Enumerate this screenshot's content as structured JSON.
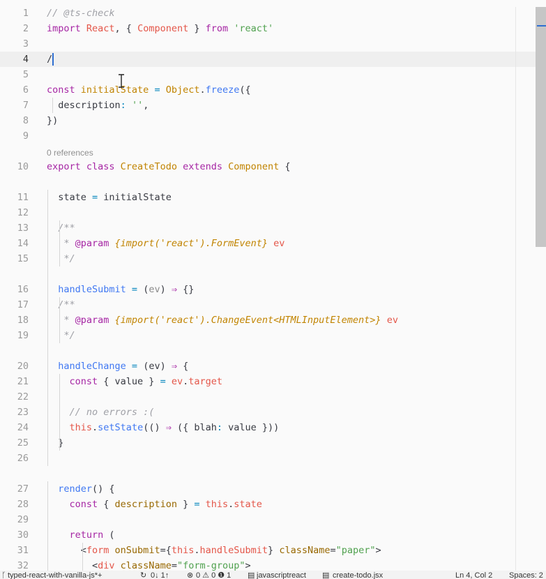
{
  "editor": {
    "codelens": "0 references",
    "lines": [
      {
        "n": "1",
        "tokens": [
          [
            "c",
            "// @ts-check"
          ]
        ]
      },
      {
        "n": "2",
        "tokens": [
          [
            "k",
            "import "
          ],
          [
            "v",
            "React"
          ],
          [
            "pl",
            ", { "
          ],
          [
            "v",
            "Component"
          ],
          [
            "pl",
            " } "
          ],
          [
            "k",
            "from "
          ],
          [
            "s",
            "'react'"
          ]
        ]
      },
      {
        "n": "3",
        "tokens": []
      },
      {
        "n": "4",
        "tokens": [
          [
            "pl",
            "/"
          ]
        ],
        "current": true
      },
      {
        "n": "5",
        "tokens": []
      },
      {
        "n": "6",
        "tokens": [
          [
            "k",
            "const "
          ],
          [
            "cls",
            "initialState"
          ],
          [
            "p",
            " = "
          ],
          [
            "cls",
            "Object"
          ],
          [
            "pl",
            "."
          ],
          [
            "fn",
            "freeze"
          ],
          [
            "pl",
            "({"
          ]
        ]
      },
      {
        "n": "7",
        "tokens": [
          [
            "pl",
            "  description"
          ],
          [
            "p",
            ": "
          ],
          [
            "s",
            "''"
          ],
          [
            "pl",
            ","
          ]
        ]
      },
      {
        "n": "8",
        "tokens": [
          [
            "pl",
            "})"
          ]
        ]
      },
      {
        "n": "9",
        "tokens": []
      },
      {
        "n": "10",
        "tokens": [
          [
            "k",
            "export class "
          ],
          [
            "cls",
            "CreateTodo "
          ],
          [
            "k",
            "extends "
          ],
          [
            "cls",
            "Component"
          ],
          [
            "pl",
            " {"
          ]
        ]
      },
      {
        "n": "11",
        "tokens": [
          [
            "pl",
            "  state "
          ],
          [
            "p",
            "= "
          ],
          [
            "pl",
            "initialState"
          ]
        ]
      },
      {
        "n": "12",
        "tokens": []
      },
      {
        "n": "13",
        "tokens": [
          [
            "c",
            "  /**"
          ]
        ]
      },
      {
        "n": "14",
        "tokens": [
          [
            "c",
            "   * "
          ],
          [
            "k",
            "@param "
          ],
          [
            "ty",
            "{import('react').FormEvent} "
          ],
          [
            "tag",
            "ev"
          ]
        ]
      },
      {
        "n": "15",
        "tokens": [
          [
            "c",
            "   */"
          ]
        ]
      },
      {
        "n": "16",
        "tokens": [
          [
            "fn",
            "  handleSubmit "
          ],
          [
            "p",
            "= "
          ],
          [
            "pl",
            "("
          ],
          [
            "pa",
            "ev"
          ],
          [
            "pl",
            ") "
          ],
          [
            "op",
            "⇒ "
          ],
          [
            "pl",
            "{}"
          ]
        ]
      },
      {
        "n": "17",
        "tokens": [
          [
            "c",
            "  /**"
          ]
        ]
      },
      {
        "n": "18",
        "tokens": [
          [
            "c",
            "   * "
          ],
          [
            "k",
            "@param "
          ],
          [
            "ty",
            "{import('react').ChangeEvent<HTMLInputElement>} "
          ],
          [
            "tag",
            "ev"
          ]
        ]
      },
      {
        "n": "19",
        "tokens": [
          [
            "c",
            "   */"
          ]
        ]
      },
      {
        "n": "20",
        "tokens": [
          [
            "fn",
            "  handleChange "
          ],
          [
            "p",
            "= "
          ],
          [
            "pl",
            "(ev) "
          ],
          [
            "op",
            "⇒ "
          ],
          [
            "pl",
            "{"
          ]
        ]
      },
      {
        "n": "21",
        "tokens": [
          [
            "k",
            "    const "
          ],
          [
            "pl",
            "{ value } "
          ],
          [
            "p",
            "= "
          ],
          [
            "v",
            "ev"
          ],
          [
            "pl",
            "."
          ],
          [
            "v",
            "target"
          ]
        ]
      },
      {
        "n": "22",
        "tokens": []
      },
      {
        "n": "23",
        "tokens": [
          [
            "c",
            "    // no errors :("
          ]
        ]
      },
      {
        "n": "24",
        "tokens": [
          [
            "v",
            "    this"
          ],
          [
            "pl",
            "."
          ],
          [
            "fn",
            "setState"
          ],
          [
            "pl",
            "(() "
          ],
          [
            "op",
            "⇒ "
          ],
          [
            "pl",
            "({ blah"
          ],
          [
            "p",
            ": "
          ],
          [
            "pl",
            "value }))"
          ]
        ]
      },
      {
        "n": "25",
        "tokens": [
          [
            "pl",
            "  }"
          ]
        ]
      },
      {
        "n": "26",
        "tokens": []
      },
      {
        "n": "27",
        "tokens": [
          [
            "fn",
            "  render"
          ],
          [
            "pl",
            "() {"
          ]
        ]
      },
      {
        "n": "28",
        "tokens": [
          [
            "k",
            "    const "
          ],
          [
            "pl",
            "{ "
          ],
          [
            "at",
            "description"
          ],
          [
            "pl",
            " } "
          ],
          [
            "p",
            "= "
          ],
          [
            "v",
            "this"
          ],
          [
            "pl",
            "."
          ],
          [
            "v",
            "state"
          ]
        ]
      },
      {
        "n": "29",
        "tokens": []
      },
      {
        "n": "30",
        "tokens": [
          [
            "k",
            "    return "
          ],
          [
            "pl",
            "("
          ]
        ]
      },
      {
        "n": "31",
        "tokens": [
          [
            "pl",
            "      <"
          ],
          [
            "tag",
            "form "
          ],
          [
            "at",
            "onSubmit"
          ],
          [
            "pl",
            "={"
          ],
          [
            "v",
            "this"
          ],
          [
            "pl",
            "."
          ],
          [
            "v",
            "handleSubmit"
          ],
          [
            "pl",
            "} "
          ],
          [
            "at",
            "className"
          ],
          [
            "pl",
            "="
          ],
          [
            "s",
            "\"paper\""
          ],
          [
            "pl",
            ">"
          ]
        ]
      },
      {
        "n": "32",
        "tokens": [
          [
            "pl",
            "        <"
          ],
          [
            "tag",
            "div "
          ],
          [
            "at",
            "className"
          ],
          [
            "pl",
            "="
          ],
          [
            "s",
            "\"form-group\""
          ],
          [
            "pl",
            ">"
          ]
        ]
      }
    ]
  },
  "status": {
    "branch": "typed-react-with-vanilla-js*+",
    "sync": "0↓ 1↑",
    "problems": "0 ⚠ 0 ❶ 1",
    "language": "javascriptreact",
    "file": "create-todo.jsx",
    "position": "Ln 4, Col 2",
    "spaces": "Spaces: 2"
  }
}
